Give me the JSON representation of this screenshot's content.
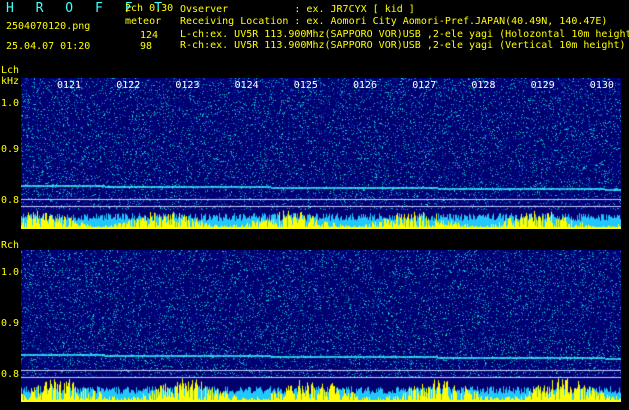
{
  "header": {
    "title": "H R O F F T",
    "version": "2ch 0.30",
    "filename": "2504070120.png",
    "meteor_label": "meteor",
    "lch_count": "124",
    "rch_count": "98",
    "datetime": "25.04.07 01:20"
  },
  "info": {
    "observer": "Ovserver           : ex. JR7CYX [ kid ]",
    "location": "Receiving Location : ex. Aomori City Aomori-Pref.JAPAN(40.49N, 140.47E)",
    "lch": "L-ch:ex. UV5R 113.900Mhz(SAPPORO VOR)USB ,2-ele yagi (Holozontal 10m height)",
    "rch": "R-ch:ex. UV5R 113.900Mhz(SAPPORO VOR)USB ,2-ele yagi (Vertical 10m height)"
  },
  "lch": {
    "channel": "Lch",
    "unit": "kHz",
    "ticks": [
      "1.0",
      "0.9",
      "0.8"
    ],
    "time_labels": [
      "0121",
      "0122",
      "0123",
      "0124",
      "0125",
      "0126",
      "0127",
      "0128",
      "0129",
      "0130"
    ]
  },
  "rch": {
    "channel": "Rch",
    "ticks": [
      "1.0",
      "0.9",
      "0.8"
    ]
  },
  "colors": {
    "label_yellow": "#ffff00",
    "header_cyan": "#40ffff",
    "spectrogram_bg": "#000070",
    "signal_cyan": "#40e0ff",
    "level_yellow": "#ffff00"
  }
}
